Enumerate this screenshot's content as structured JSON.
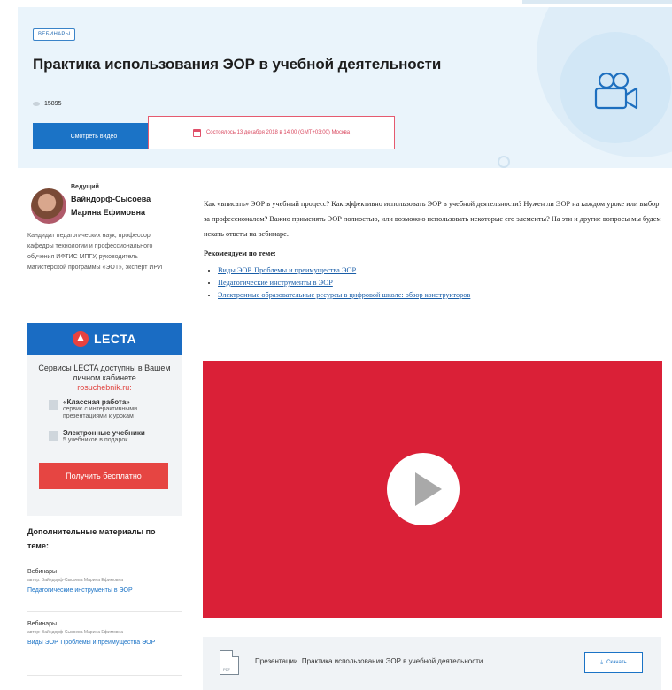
{
  "header": {
    "badge": "Вебинары",
    "title": "Практика использования ЭОР в учебной деятельности",
    "views": "15895",
    "watch_button": "Смотреть видео",
    "date_button": "Состоялось 13 декабря 2018 в 14:00 (GMT+03:00) Москва",
    "icon": "video-camera-icon"
  },
  "host": {
    "role": "Ведущий",
    "name": "Вайндорф-Сысоева Марина Ефимовна",
    "description": "Кандидат педагогических наук, профессор кафедры технологии и профессионального обучения ИФТИС МПГУ, руководитель магистерской программы «ЭОТ», эксперт ИРИ"
  },
  "promo": {
    "brand": "LECTA",
    "text": "Сервисы LECTA доступны в Вашем личном кабинете",
    "link": "rosuchebnik.ru:",
    "items": [
      {
        "title": "«Классная работа»",
        "desc": "сервис с интерактивными презентациями к урокам"
      },
      {
        "title": "Электронные учебники",
        "desc": "5 учебников в подарок"
      }
    ],
    "button": "Получить бесплатно"
  },
  "materials": {
    "title": "Дополнительные материалы по теме:",
    "items": [
      {
        "type": "Вебинары",
        "author": "автор: Вайндорф-Сысоева Марина Ефимовна",
        "link": "Педагогические инструменты в ЭОР"
      },
      {
        "type": "Вебинары",
        "author": "автор: Вайндорф-Сысоева Марина Ефимовна",
        "link": "Виды ЭОР. Проблемы и преимущества ЭОР"
      }
    ]
  },
  "content": {
    "intro": "Как «вписать» ЭОР в учебный процесс? Как эффективно использовать ЭОР в учебной деятельности? Нужен ли ЭОР на каждом уроке или выбор за профессионалом? Важно применять ЭОР полностью, или возможно использовать некоторые его элементы? На эти и другие вопросы мы будем искать ответы на вебинаре.",
    "recommend_title": "Рекомендуем по теме:",
    "recommend": [
      "Виды ЭОР. Проблемы и преимущества ЭОР",
      "Педагогические инструменты в ЭОР",
      "Электронные образовательные ресурсы в цифровой школе: обзор конструкторов"
    ]
  },
  "video": {
    "color": "#da2037",
    "icon": "play-icon"
  },
  "file": {
    "ext": "PDF",
    "name": "Презентации. Практика использования ЭОР в учебной деятельности",
    "download": "Скачать"
  }
}
